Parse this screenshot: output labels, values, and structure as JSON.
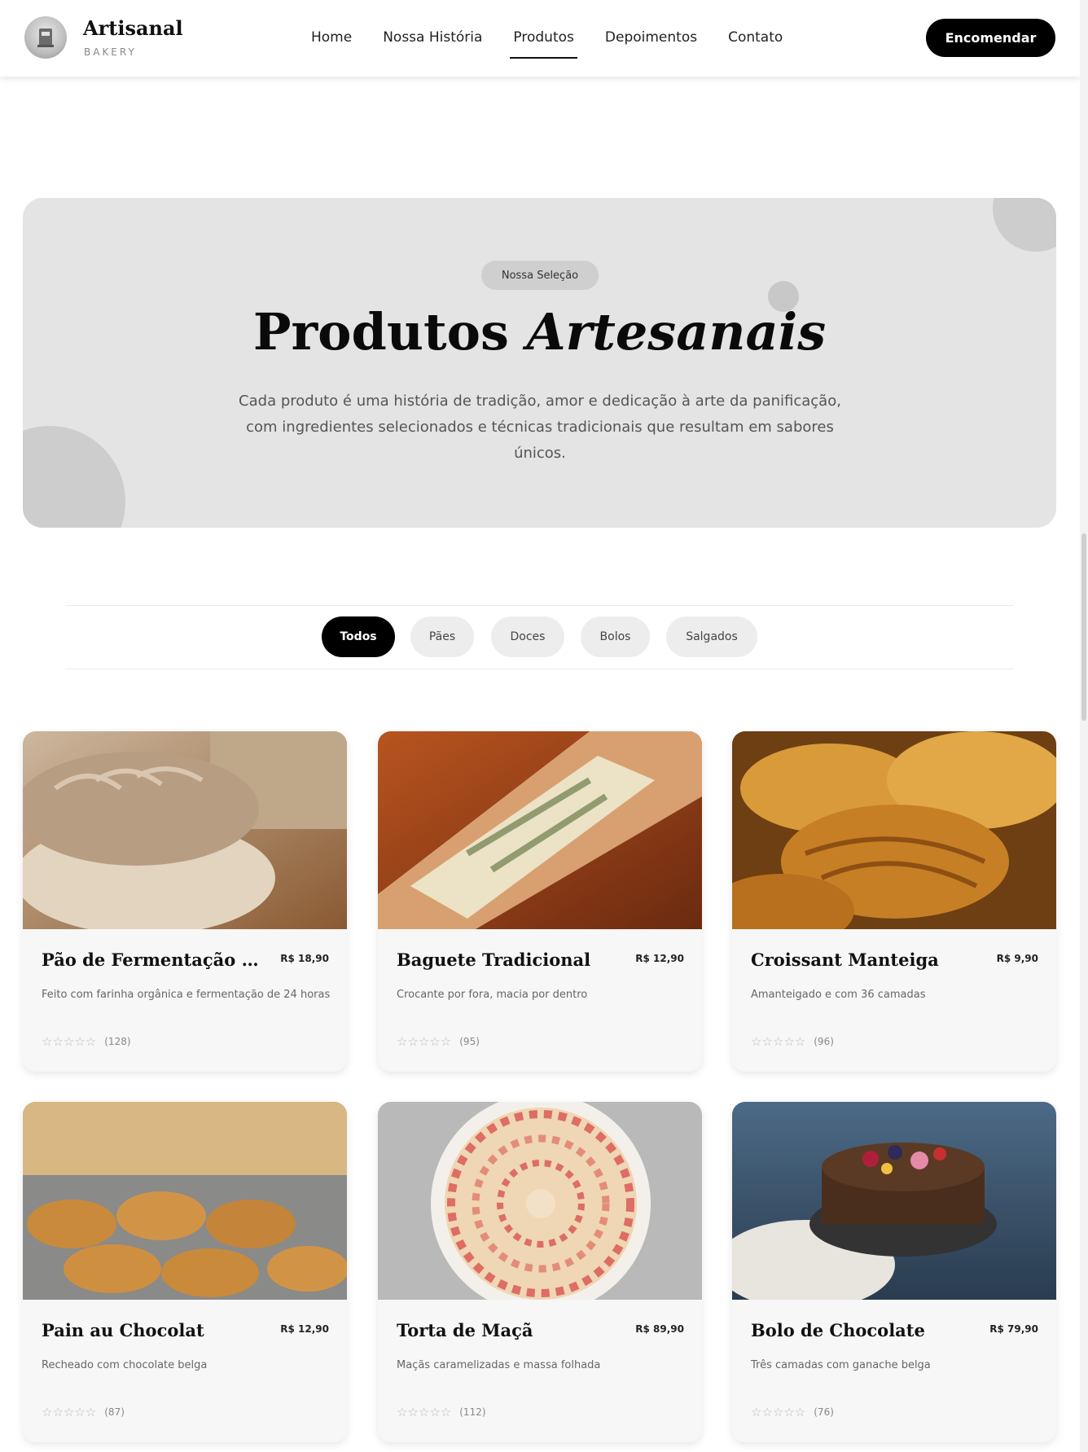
{
  "header": {
    "brand_name": "Artisanal",
    "brand_sub": "BAKERY",
    "nav": [
      {
        "label": "Home"
      },
      {
        "label": "Nossa História"
      },
      {
        "label": "Produtos"
      },
      {
        "label": "Depoimentos"
      },
      {
        "label": "Contato"
      }
    ],
    "active_nav": "Produtos",
    "cta_label": "Encomendar"
  },
  "hero": {
    "badge": "Nossa Seleção",
    "title_plain": "Produtos",
    "title_italic": "Artesanais",
    "description": "Cada produto é uma história de tradição, amor e dedicação à arte da panificação, com ingredientes selecionados e técnicas tradicionais que resultam em sabores únicos."
  },
  "filters": {
    "items": [
      {
        "label": "Todos",
        "active": true
      },
      {
        "label": "Pães",
        "active": false
      },
      {
        "label": "Doces",
        "active": false
      },
      {
        "label": "Bolos",
        "active": false
      },
      {
        "label": "Salgados",
        "active": false
      }
    ]
  },
  "products": [
    {
      "name": "Pão de Fermentação Nat...",
      "price": "R$ 18,90",
      "description": "Feito com farinha orgânica e fermentação de 24 horas",
      "stars": "☆☆☆☆☆",
      "reviews": "(128)",
      "image_icon": "sourdough-bread-photo"
    },
    {
      "name": "Baguete Tradicional",
      "price": "R$ 12,90",
      "description": "Crocante por fora, macia por dentro",
      "stars": "☆☆☆☆☆",
      "reviews": "(95)",
      "image_icon": "baguette-photo"
    },
    {
      "name": "Croissant Manteiga",
      "price": "R$ 9,90",
      "description": "Amanteigado e com 36 camadas",
      "stars": "☆☆☆☆☆",
      "reviews": "(96)",
      "image_icon": "croissant-photo"
    },
    {
      "name": "Pain au Chocolat",
      "price": "R$ 12,90",
      "description": "Recheado com chocolate belga",
      "stars": "☆☆☆☆☆",
      "reviews": "(87)",
      "image_icon": "pain-au-chocolat-photo"
    },
    {
      "name": "Torta de Maçã",
      "price": "R$ 89,90",
      "description": "Maçãs caramelizadas e massa folhada",
      "stars": "☆☆☆☆☆",
      "reviews": "(112)",
      "image_icon": "apple-tart-photo"
    },
    {
      "name": "Bolo de Chocolate",
      "price": "R$ 79,90",
      "description": "Três camadas com ganache belga",
      "stars": "☆☆☆☆☆",
      "reviews": "(76)",
      "image_icon": "chocolate-cake-photo"
    }
  ],
  "colors": {
    "primary": "#000000",
    "hero_bg": "#e4e4e4",
    "card_bg": "#f7f7f7"
  }
}
